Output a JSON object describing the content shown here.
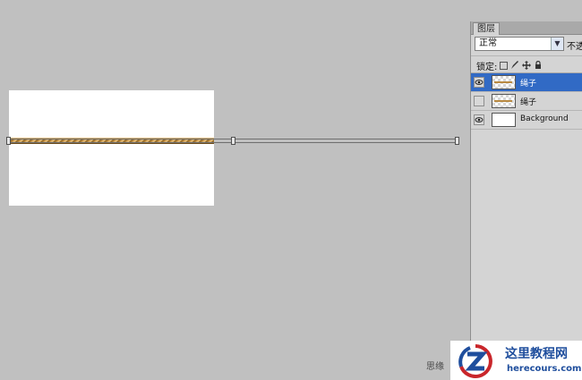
{
  "canvas": {
    "layer_content": "rope"
  },
  "layers_panel": {
    "tab_label": "图层",
    "blend_mode": "正常",
    "opacity_label": "不透",
    "lock_label": "锁定:",
    "lock_icons": [
      "lock-transparent-icon",
      "lock-brush-icon",
      "lock-move-icon",
      "lock-all-icon"
    ],
    "layers": [
      {
        "name": "绳子",
        "visible": true,
        "selected": true,
        "thumb": "rope"
      },
      {
        "name": "绳子",
        "visible": false,
        "selected": false,
        "thumb": "rope"
      },
      {
        "name": "Background",
        "visible": true,
        "selected": false,
        "thumb": "white"
      }
    ]
  },
  "watermark": {
    "left_text": "思缘",
    "site_cn": "这里教程网",
    "site_url": "herecours.com"
  },
  "colors": {
    "workspace": "#c0c0c0",
    "selection": "#316ac5",
    "brand": "#1f4e9d"
  }
}
